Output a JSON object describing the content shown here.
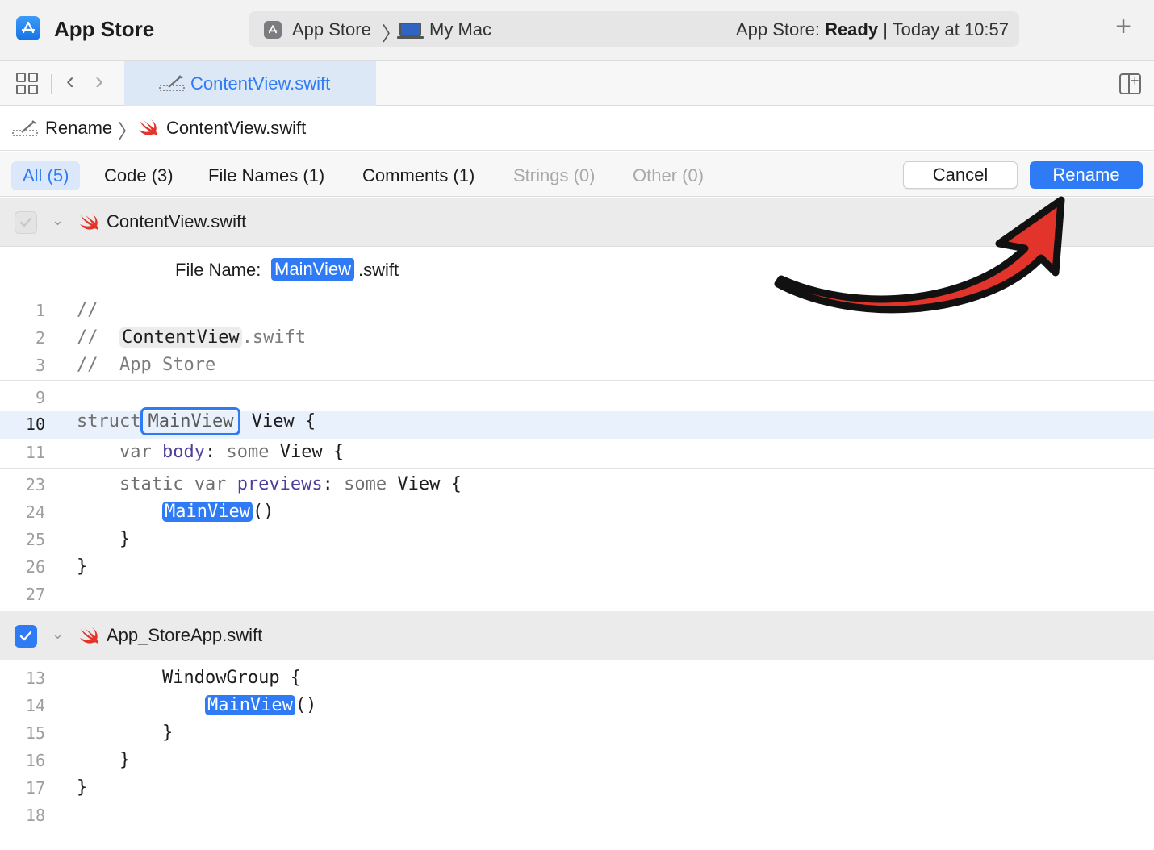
{
  "titlebar": {
    "app_title": "App Store",
    "scheme": "App Store",
    "device": "My Mac",
    "status_prefix": "App Store:",
    "status_state": "Ready",
    "status_time": "| Today at 10:57"
  },
  "tabbar": {
    "active_tab": "ContentView.swift"
  },
  "breadcrumb": {
    "item1": "Rename",
    "item2": "ContentView.swift"
  },
  "filters": {
    "all": "All (5)",
    "code": "Code (3)",
    "file_names": "File Names (1)",
    "comments": "Comments (1)",
    "strings": "Strings (0)",
    "other": "Other (0)"
  },
  "actions": {
    "cancel": "Cancel",
    "rename": "Rename"
  },
  "file1": {
    "name": "ContentView.swift",
    "file_name_label": "File Name:",
    "new_name": "MainView",
    "ext": ".swift",
    "lines": [
      {
        "n": "1"
      },
      {
        "n": "2"
      },
      {
        "n": "3"
      },
      {
        "n": "9"
      },
      {
        "n": "10"
      },
      {
        "n": "11"
      },
      {
        "n": "23"
      },
      {
        "n": "24"
      },
      {
        "n": "25"
      },
      {
        "n": "26"
      },
      {
        "n": "27"
      }
    ],
    "code": {
      "l1": "//",
      "l2_prefix": "//  ",
      "l2_old": "ContentView",
      "l2_ext": ".swift",
      "l3": "//  App Store",
      "l10_kw": "struct",
      "l10_name": "MainView",
      "l10_rest": " View {",
      "l11_kw": "var",
      "l11_prop": "body",
      "l11_colon": ":",
      "l11_some": "some",
      "l11_rest": " View {",
      "l23_kw": "static var",
      "l23_prop": "previews",
      "l23_colon": ":",
      "l23_some": "some",
      "l23_rest": " View {",
      "l24_name": "MainView",
      "l24_rest": "()",
      "l25": "}",
      "l26": "}"
    }
  },
  "file2": {
    "name": "App_StoreApp.swift",
    "lines": [
      {
        "n": "13"
      },
      {
        "n": "14"
      },
      {
        "n": "15"
      },
      {
        "n": "16"
      },
      {
        "n": "17"
      },
      {
        "n": "18"
      }
    ],
    "code": {
      "l13": "WindowGroup {",
      "l14_name": "MainView",
      "l14_rest": "()",
      "l15": "}",
      "l16": "}",
      "l17": "}"
    }
  },
  "colors": {
    "accent": "#2f7bf5",
    "arrow": "#e2342b"
  }
}
